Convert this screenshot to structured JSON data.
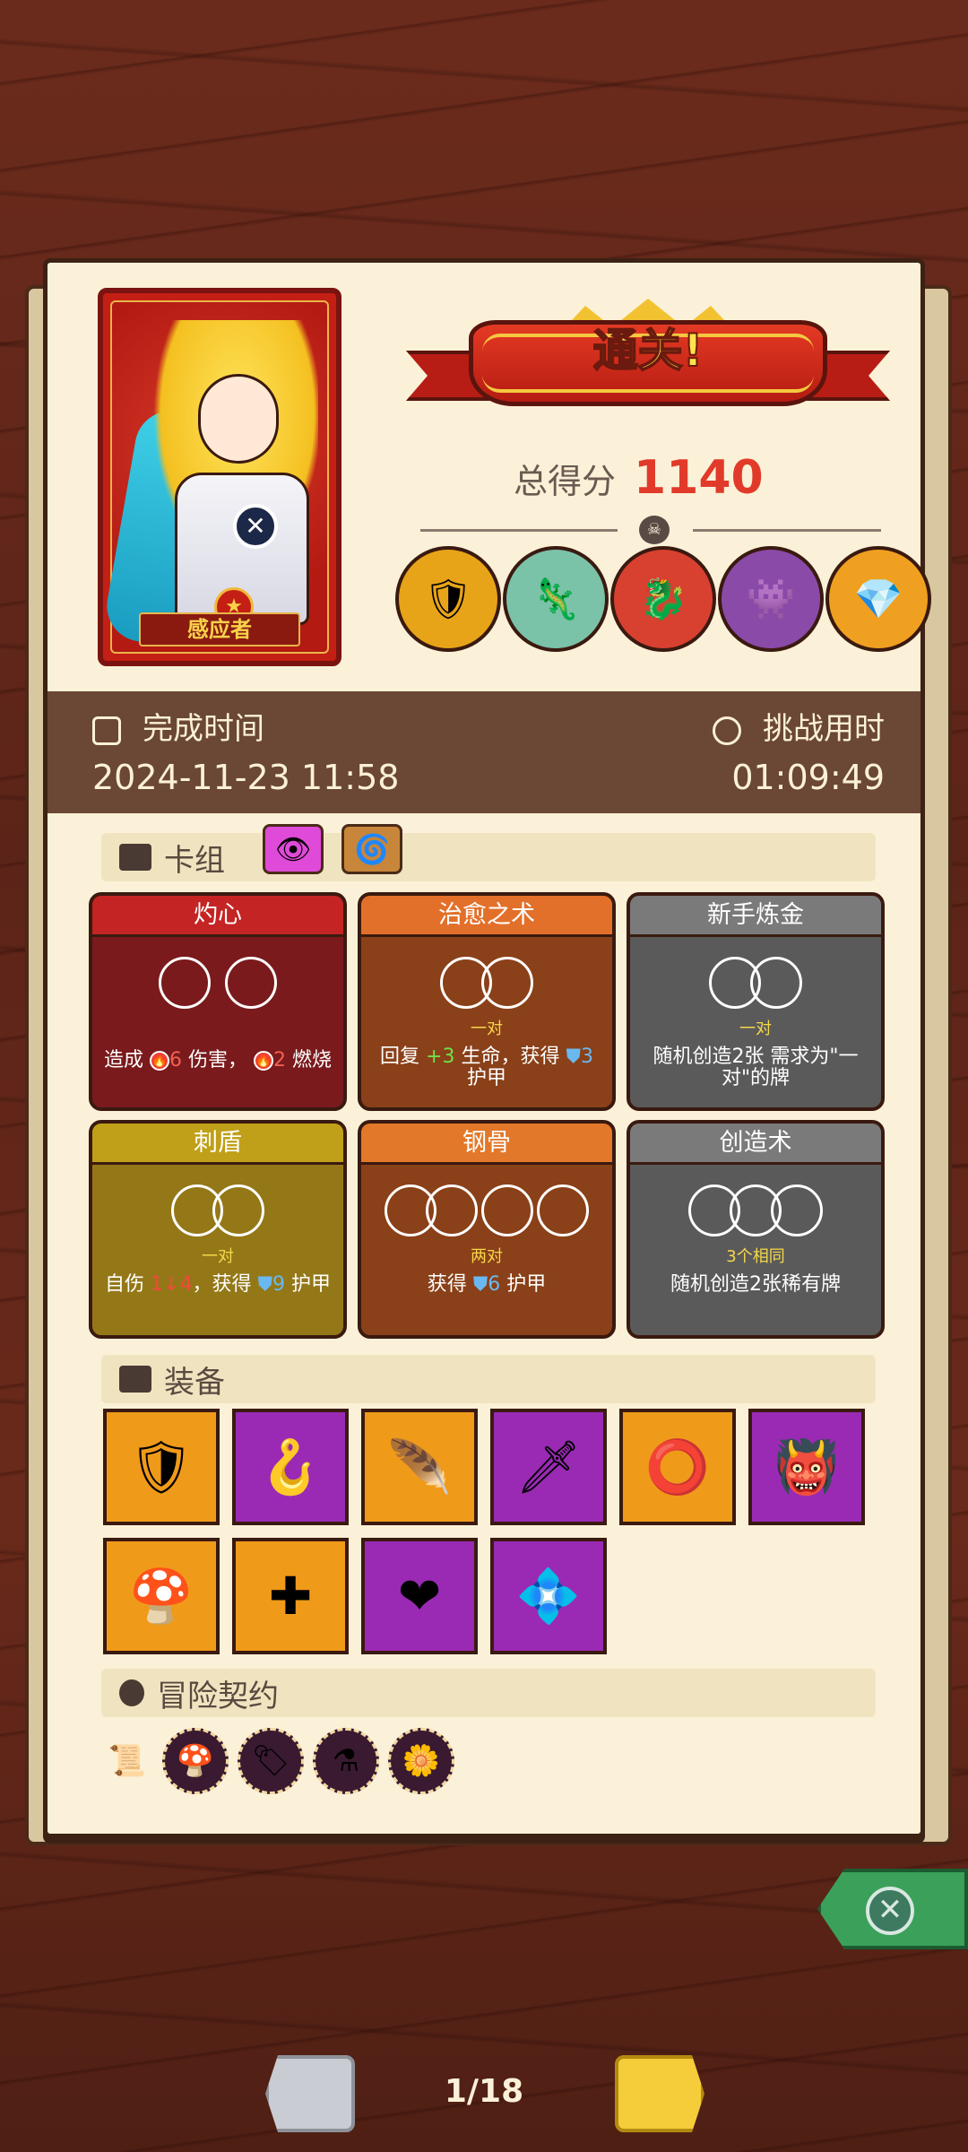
{
  "result": {
    "banner_title": "通关!",
    "score_label": "总得分",
    "score_value": "1140",
    "character_name": "感应者"
  },
  "bosses": [
    "knight-boss-icon",
    "lizard-boss-icon",
    "dragon-boss-icon",
    "purple-beast-boss-icon",
    "crystal-golem-boss-icon"
  ],
  "time": {
    "complete_label": "完成时间",
    "complete_value": "2024-11-23 11:58",
    "duration_label": "挑战用时",
    "duration_value": "01:09:49"
  },
  "deck": {
    "section_label": "卡组",
    "cards": [
      {
        "name": "灼心",
        "sub": "",
        "desc_parts": [
          "造成",
          "6",
          "伤害，",
          "2",
          "燃烧"
        ],
        "color": "#7a1a1c",
        "header_color": "#c42424"
      },
      {
        "name": "治愈之术",
        "sub": "一对",
        "desc_parts": [
          "回复",
          "+3",
          "生命，获得",
          "3",
          "护甲"
        ],
        "color": "#8a4018",
        "header_color": "#e2702a"
      },
      {
        "name": "新手炼金",
        "sub": "一对",
        "desc": "随机创造2张 需求为\"一对\"的牌",
        "color": "#5a5a5a",
        "header_color": "#7a7a7a"
      },
      {
        "name": "刺盾",
        "sub": "一对",
        "desc_parts": [
          "自伤",
          "1↓4",
          "，获得",
          "9",
          "护甲"
        ],
        "color": "#947818",
        "header_color": "#c0a018"
      },
      {
        "name": "钢骨",
        "sub": "两对",
        "desc_parts": [
          "获得",
          "6",
          "护甲"
        ],
        "color": "#8a4018",
        "header_color": "#e2782a"
      },
      {
        "name": "创造术",
        "sub": "3个相同",
        "desc": "随机创造2张稀有牌",
        "color": "#5a5a5a",
        "header_color": "#7a7a7a"
      }
    ]
  },
  "equipment": {
    "section_label": "装备",
    "items": [
      {
        "icon": "crystal-shield-icon",
        "rarity": "o"
      },
      {
        "icon": "blue-hook-icon",
        "rarity": "p"
      },
      {
        "icon": "green-feather-icon",
        "rarity": "o"
      },
      {
        "icon": "crystal-dagger-icon",
        "rarity": "p"
      },
      {
        "icon": "lava-ring-icon",
        "rarity": "o"
      },
      {
        "icon": "demon-mask-icon",
        "rarity": "p"
      },
      {
        "icon": "blue-mushroom-icon",
        "rarity": "o"
      },
      {
        "icon": "golden-cross-icon",
        "rarity": "o"
      },
      {
        "icon": "heart-stone-icon",
        "rarity": "p"
      },
      {
        "icon": "green-gem-icon",
        "rarity": "p"
      }
    ]
  },
  "contracts": {
    "section_label": "冒险契约",
    "items": [
      "scroll-icon",
      "mushroom-contract-icon",
      "tag-contract-icon",
      "potion-contract-icon",
      "flower-contract-icon"
    ]
  },
  "pager": {
    "label": "1/18"
  },
  "colors": {
    "accent_red": "#e23a2a",
    "paper": "#fbf1d8",
    "strip": "#6b4736"
  }
}
